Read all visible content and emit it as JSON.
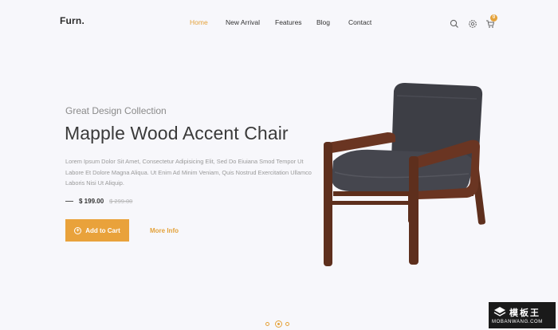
{
  "header": {
    "brand": "Furn.",
    "nav": [
      {
        "label": "Home",
        "active": true
      },
      {
        "label": "New Arrival",
        "active": false
      },
      {
        "label": "Features",
        "active": false
      },
      {
        "label": "Blog",
        "active": false
      },
      {
        "label": "Contact",
        "active": false
      }
    ],
    "icons": [
      "search-icon",
      "settings-icon",
      "cart-icon"
    ],
    "cart_count": "0"
  },
  "hero": {
    "subtitle": "Great Design Collection",
    "title": "Mapple Wood Accent Chair",
    "description": "Lorem Ipsum Dolor Sit Amet, Consectetur Adipisicing Elit, Sed Do Eiuiana Smod Tempor Ut Labore Et Dolore Magna Aliqua. Ut Enim Ad Minim Veniam, Quis Nostrud Exercitation Ullamco Laboris Nisi Ut Aliquip.",
    "price": "$ 199.00",
    "old_price": "$ 299.00",
    "add_to_cart_label": "Add to Cart",
    "more_info_label": "More Info"
  },
  "slider": {
    "slide_count": 3,
    "active_index": 1
  },
  "watermark": {
    "top_text": "模板王",
    "bottom_text": "MOBANWANG.COM"
  },
  "colors": {
    "accent": "#e9a23b",
    "background": "#f7f7fb",
    "text": "#333333",
    "chair_fabric": "#3d3e45",
    "chair_wood": "#5e2f1d"
  }
}
